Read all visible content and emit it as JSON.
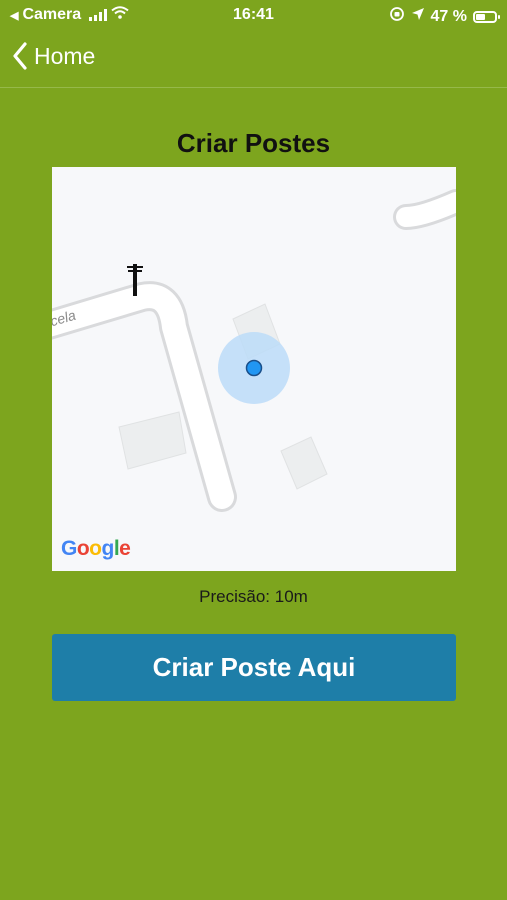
{
  "status_bar": {
    "carrier": "Camera",
    "time": "16:41",
    "battery_percent": "47 %",
    "battery_level": 0.47
  },
  "nav": {
    "back_label": "Home"
  },
  "page": {
    "title": "Criar Postes"
  },
  "map": {
    "street_label": "cela",
    "provider_logo": "Google",
    "marker_icon": "utility-pole-icon",
    "location_icon": "user-location-dot"
  },
  "precision_text": "Precisão: 10m",
  "create_button_label": "Criar Poste Aqui",
  "colors": {
    "background": "#7da51e",
    "button": "#1e7ea8",
    "location_dot": "#2196f3"
  }
}
